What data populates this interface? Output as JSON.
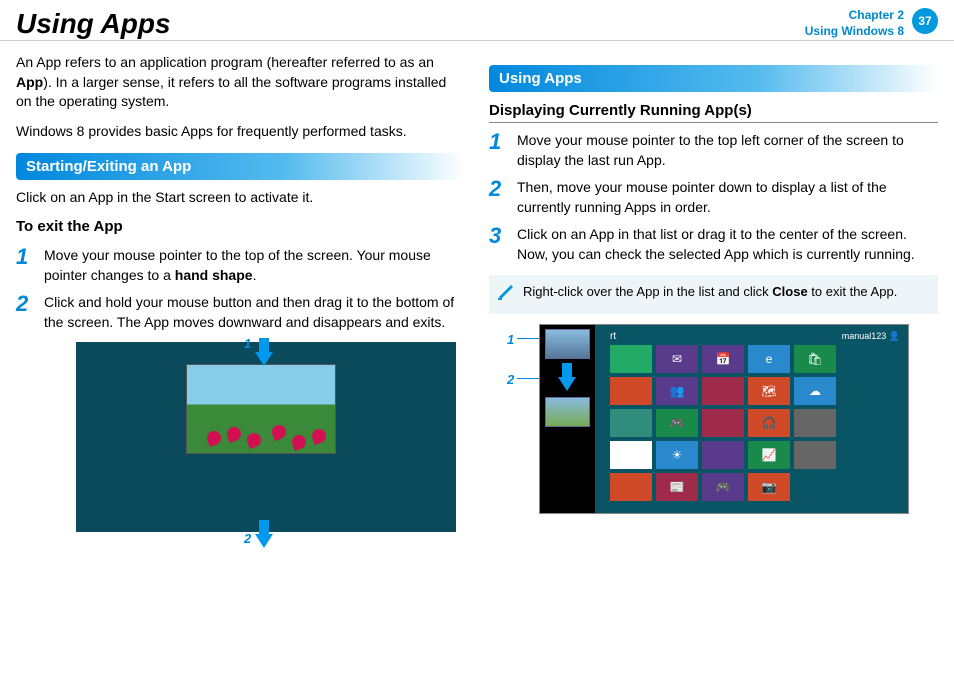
{
  "header": {
    "title": "Using Apps",
    "chapter_line1": "Chapter 2",
    "chapter_line2": "Using Windows 8",
    "page_number": "37"
  },
  "left": {
    "intro1_a": "An App refers to an application program (hereafter referred to as an ",
    "intro1_bold": "App",
    "intro1_b": "). In a larger sense, it refers to all the software programs installed on the operating system.",
    "intro2": "Windows 8 provides basic Apps for frequently performed tasks.",
    "section1": "Starting/Exiting an App",
    "click_text": "Click on an App in the Start screen to activate it.",
    "exit_heading": "To exit the App",
    "step1num": "1",
    "step1_a": " Move your mouse pointer to the top of the screen. Your mouse pointer changes to a ",
    "step1_bold": "hand shape",
    "step1_b": ".",
    "step2num": "2",
    "step2": "Click and hold your mouse button and then drag it to the bottom of the screen. The App moves downward and disappears and exits.",
    "callout1": "1",
    "callout2": "2"
  },
  "right": {
    "section2": "Using Apps",
    "subheading": "Displaying Currently Running App(s)",
    "step1num": "1",
    "step1": "Move your mouse pointer to the top left corner of the screen to display the last run App.",
    "step2num": "2",
    "step2": "Then, move your mouse pointer down to display a list of the currently running Apps in order.",
    "step3num": "3",
    "step3": "Click on an App in that list or drag it to the center of the screen. Now, you can check the selected App which is currently running.",
    "note_a": "Right-click over the App in the list and click ",
    "note_bold": "Close",
    "note_b": " to exit the App.",
    "callout1": "1",
    "callout2": "2",
    "start_label": "rt",
    "user_label": "manual123"
  }
}
